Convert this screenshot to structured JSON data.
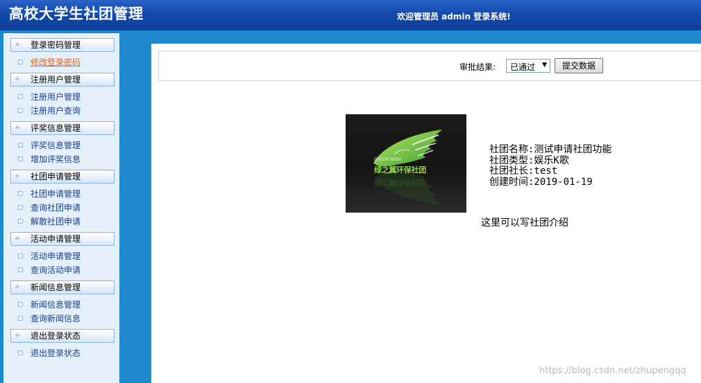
{
  "header": {
    "title": "高校大学生社团管理",
    "welcome": "欢迎管理员 admin 登录系统!"
  },
  "sidebar": {
    "groups": [
      {
        "title": "登录密码管理",
        "items": [
          "修改登录密码"
        ]
      },
      {
        "title": "注册用户管理",
        "items": [
          "注册用户管理",
          "注册用户查询"
        ]
      },
      {
        "title": "评奖信息管理",
        "items": [
          "评奖信息管理",
          "增加评奖信息"
        ]
      },
      {
        "title": "社团申请管理",
        "items": [
          "社团申请管理",
          "查询社团申请",
          "解散社团申请"
        ]
      },
      {
        "title": "活动申请管理",
        "items": [
          "活动申请管理",
          "查询活动申请"
        ]
      },
      {
        "title": "新闻信息管理",
        "items": [
          "新闻信息管理",
          "查询新闻信息"
        ]
      },
      {
        "title": "退出登录状态",
        "items": [
          "退出登录状态"
        ]
      }
    ],
    "active_item": "修改登录密码"
  },
  "toolbar": {
    "result_label": "审批结果:",
    "select_value": "已通过",
    "submit_label": "提交数据"
  },
  "club": {
    "logo_text": "绿之翼环保社团",
    "logo_english": "GREEN WING",
    "details": [
      "社团名称:测试申请社团功能",
      "社团类型:娱乐K歌",
      "社团社长:test",
      "创建时间:2019-01-19"
    ],
    "intro": "这里可以写社团介绍"
  },
  "watermark": "https://blog.csdn.net/zhupengqq",
  "colors": {
    "header": "#1449ad",
    "frame": "#2088cc",
    "sidebar_bg": "#e5f0fb",
    "active_link": "#e4631a",
    "logo_green": "#8fd64a"
  }
}
